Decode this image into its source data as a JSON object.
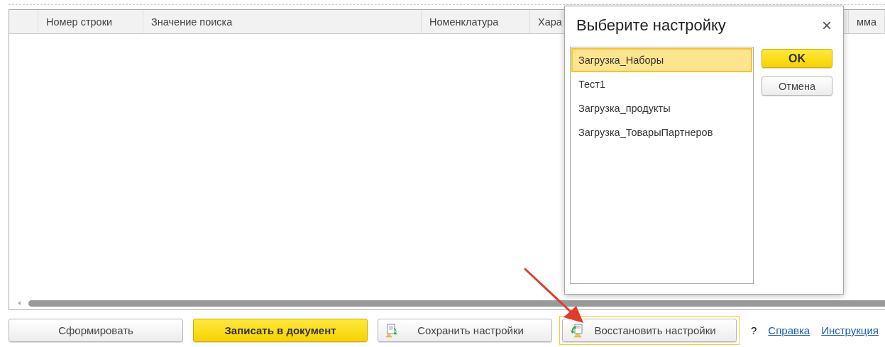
{
  "table": {
    "columns": [
      {
        "label": "Номер строки"
      },
      {
        "label": "Значение поиска"
      },
      {
        "label": "Номенклатура"
      },
      {
        "label": "Хара"
      },
      {
        "label": "мма"
      }
    ]
  },
  "buttons": [
    {
      "label": "Сформировать",
      "kind": "default",
      "focused": false
    },
    {
      "label": "Записать в документ",
      "kind": "primary",
      "focused": false
    },
    {
      "label": "Сохранить настройки",
      "kind": "save",
      "focused": false
    },
    {
      "label": "Восстановить настройки",
      "kind": "restore",
      "focused": true
    }
  ],
  "help": {
    "mark": "?",
    "links": [
      "Справка",
      "Инструкция"
    ]
  },
  "dialog": {
    "title": "Выберите настройку",
    "close": "×",
    "items": [
      {
        "label": "Загрузка_Наборы",
        "selected": true
      },
      {
        "label": "Тест1",
        "selected": false
      },
      {
        "label": "Загрузка_продукты",
        "selected": false
      },
      {
        "label": "Загрузка_ТоварыПартнеров",
        "selected": false
      }
    ],
    "buttons": [
      {
        "label": "OK",
        "kind": "primary"
      },
      {
        "label": "Отмена",
        "kind": "default"
      }
    ]
  }
}
